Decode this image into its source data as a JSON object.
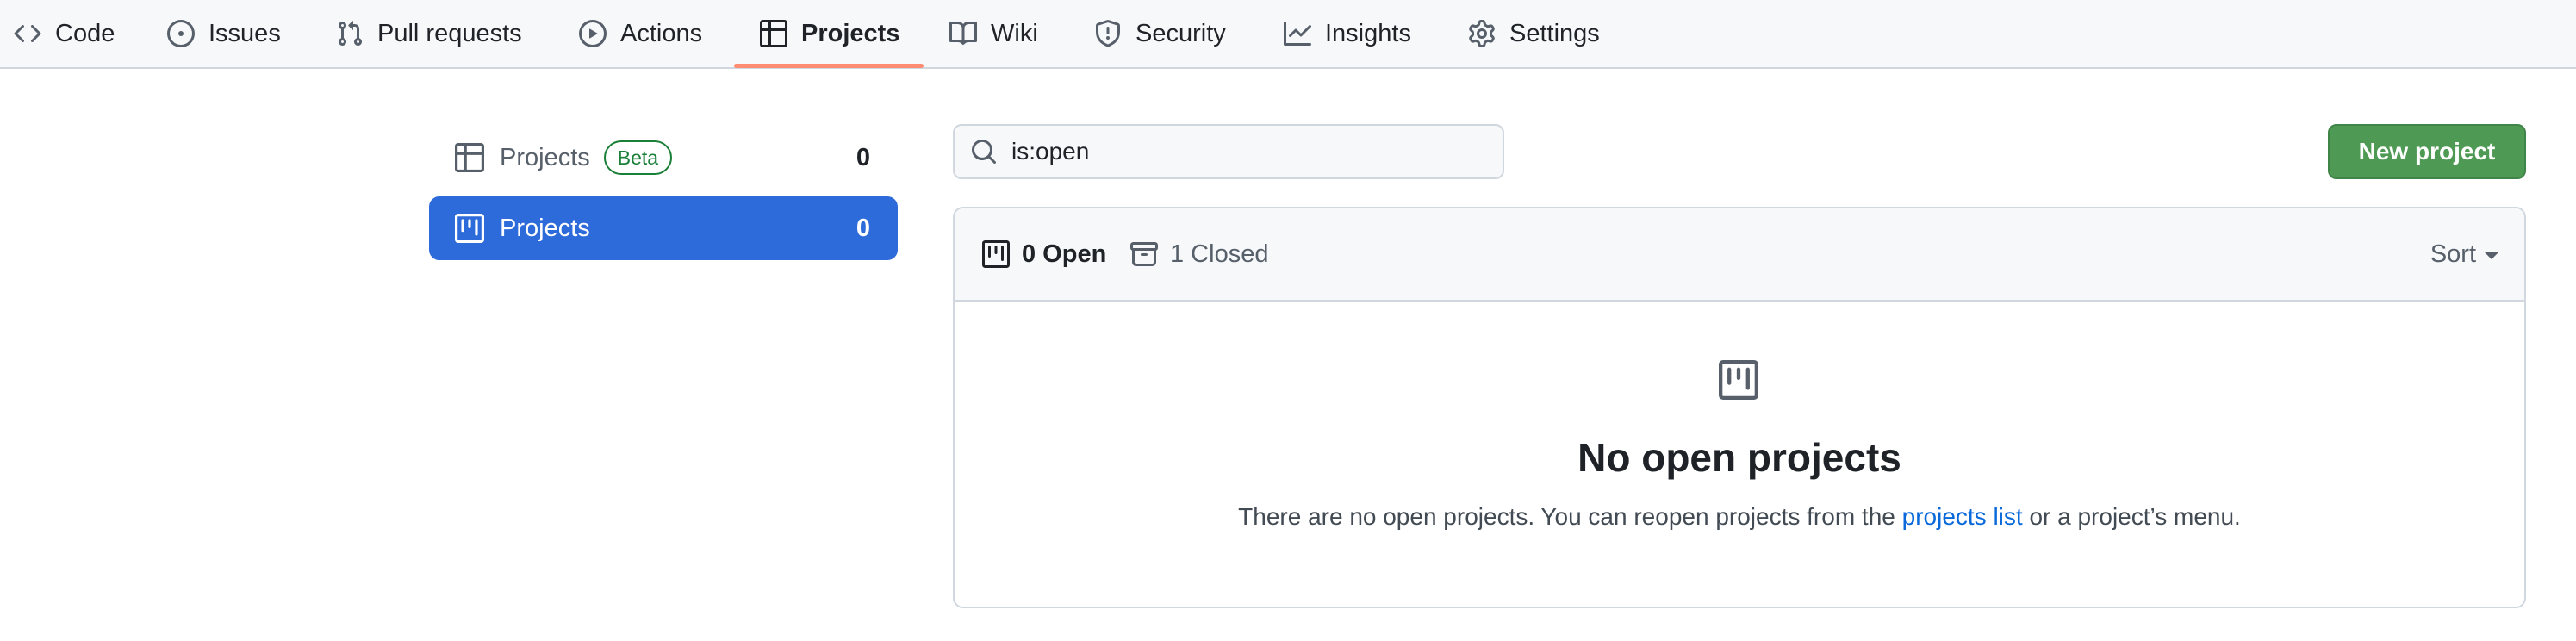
{
  "nav": {
    "tabs": [
      {
        "label": "Code",
        "icon": "code-icon"
      },
      {
        "label": "Issues",
        "icon": "issue-opened-icon"
      },
      {
        "label": "Pull requests",
        "icon": "git-pull-request-icon"
      },
      {
        "label": "Actions",
        "icon": "play-icon"
      },
      {
        "label": "Projects",
        "icon": "table-icon",
        "selected": true
      },
      {
        "label": "Wiki",
        "icon": "book-icon"
      },
      {
        "label": "Security",
        "icon": "shield-icon"
      },
      {
        "label": "Insights",
        "icon": "graph-icon"
      },
      {
        "label": "Settings",
        "icon": "gear-icon"
      }
    ],
    "underline_color": "#fd8c73"
  },
  "sidebar": {
    "items": [
      {
        "label": "Projects",
        "badge": "Beta",
        "count": "0",
        "icon": "table-icon"
      },
      {
        "label": "Projects",
        "count": "0",
        "icon": "project-icon",
        "selected": true
      }
    ],
    "selected_color": "#2c6bd9",
    "badge_color": "#1a7f37"
  },
  "search": {
    "value": "is:open",
    "icon": "search-icon"
  },
  "new_project_button": {
    "label": "New project",
    "color": "#4e9a54"
  },
  "projects_box": {
    "open_label": "0 Open",
    "closed_label": "1 Closed",
    "sort_label": "Sort",
    "empty_state": {
      "icon": "project-icon",
      "title": "No open projects",
      "text_before": "There are no open projects. You can reopen projects from the ",
      "link": "projects list",
      "text_after": " or a project’s menu.",
      "link_color": "#0969da"
    }
  }
}
